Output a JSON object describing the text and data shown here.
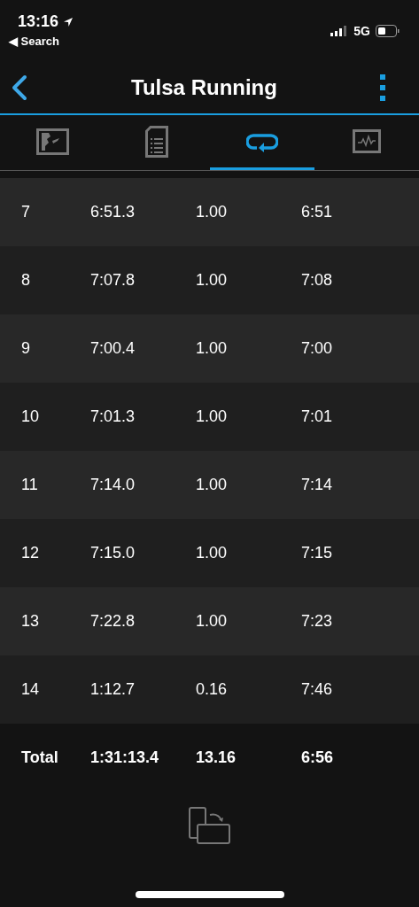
{
  "status_bar": {
    "time": "13:16",
    "back_label": "◀ Search",
    "network": "5G"
  },
  "header": {
    "title": "Tulsa Running"
  },
  "tabs": [
    {
      "kind": "map",
      "selected": false
    },
    {
      "kind": "details",
      "selected": false
    },
    {
      "kind": "laps",
      "selected": true
    },
    {
      "kind": "chart",
      "selected": false
    }
  ],
  "table": {
    "rows": [
      {
        "cells": [
          "7",
          "6:51.3",
          "1.00",
          "6:51"
        ]
      },
      {
        "cells": [
          "8",
          "7:07.8",
          "1.00",
          "7:08"
        ]
      },
      {
        "cells": [
          "9",
          "7:00.4",
          "1.00",
          "7:00"
        ]
      },
      {
        "cells": [
          "10",
          "7:01.3",
          "1.00",
          "7:01"
        ]
      },
      {
        "cells": [
          "11",
          "7:14.0",
          "1.00",
          "7:14"
        ]
      },
      {
        "cells": [
          "12",
          "7:15.0",
          "1.00",
          "7:15"
        ]
      },
      {
        "cells": [
          "13",
          "7:22.8",
          "1.00",
          "7:23"
        ]
      },
      {
        "cells": [
          "14",
          "1:12.7",
          "0.16",
          "7:46"
        ]
      }
    ],
    "total": [
      "Total",
      "1:31:13.4",
      "13.16",
      "6:56"
    ]
  }
}
